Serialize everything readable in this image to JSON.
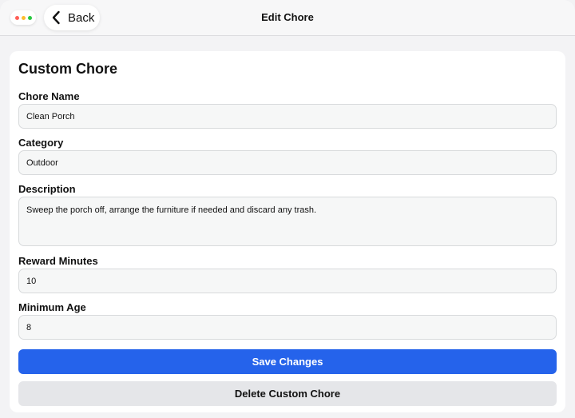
{
  "navbar": {
    "back_label": "Back",
    "title": "Edit Chore"
  },
  "window_controls": {
    "colors": [
      "#ff5f57",
      "#febc2e",
      "#28c840"
    ]
  },
  "form": {
    "heading": "Custom Chore",
    "fields": {
      "chore_name": {
        "label": "Chore Name",
        "value": "Clean Porch"
      },
      "category": {
        "label": "Category",
        "value": "Outdoor"
      },
      "description": {
        "label": "Description",
        "value": "Sweep the porch off, arrange the furniture if needed and discard any trash."
      },
      "reward_minutes": {
        "label": "Reward Minutes",
        "value": "10"
      },
      "minimum_age": {
        "label": "Minimum Age",
        "value": "8"
      }
    },
    "save_label": "Save Changes",
    "delete_label": "Delete Custom Chore"
  },
  "colors": {
    "accent": "#2563eb",
    "secondary_button": "#e5e6e9"
  }
}
